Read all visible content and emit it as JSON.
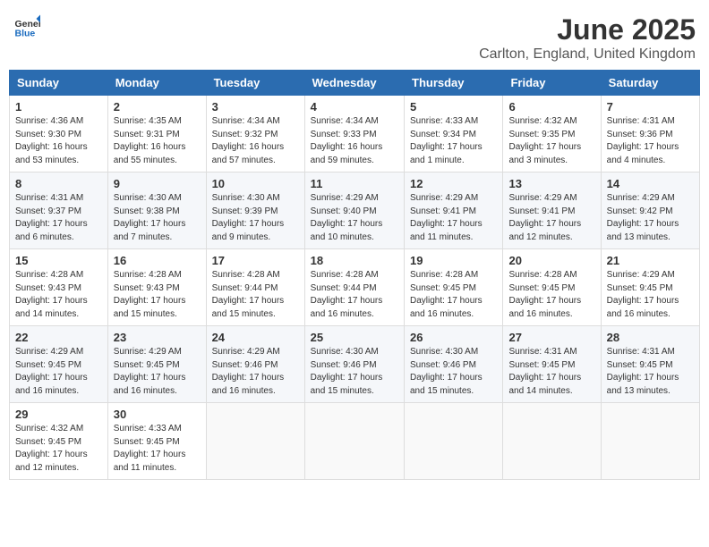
{
  "header": {
    "logo_general": "General",
    "logo_blue": "Blue",
    "title": "June 2025",
    "subtitle": "Carlton, England, United Kingdom"
  },
  "days_of_week": [
    "Sunday",
    "Monday",
    "Tuesday",
    "Wednesday",
    "Thursday",
    "Friday",
    "Saturday"
  ],
  "weeks": [
    [
      {
        "day": "1",
        "sunrise": "4:36 AM",
        "sunset": "9:30 PM",
        "daylight": "16 hours and 53 minutes."
      },
      {
        "day": "2",
        "sunrise": "4:35 AM",
        "sunset": "9:31 PM",
        "daylight": "16 hours and 55 minutes."
      },
      {
        "day": "3",
        "sunrise": "4:34 AM",
        "sunset": "9:32 PM",
        "daylight": "16 hours and 57 minutes."
      },
      {
        "day": "4",
        "sunrise": "4:34 AM",
        "sunset": "9:33 PM",
        "daylight": "16 hours and 59 minutes."
      },
      {
        "day": "5",
        "sunrise": "4:33 AM",
        "sunset": "9:34 PM",
        "daylight": "17 hours and 1 minute."
      },
      {
        "day": "6",
        "sunrise": "4:32 AM",
        "sunset": "9:35 PM",
        "daylight": "17 hours and 3 minutes."
      },
      {
        "day": "7",
        "sunrise": "4:31 AM",
        "sunset": "9:36 PM",
        "daylight": "17 hours and 4 minutes."
      }
    ],
    [
      {
        "day": "8",
        "sunrise": "4:31 AM",
        "sunset": "9:37 PM",
        "daylight": "17 hours and 6 minutes."
      },
      {
        "day": "9",
        "sunrise": "4:30 AM",
        "sunset": "9:38 PM",
        "daylight": "17 hours and 7 minutes."
      },
      {
        "day": "10",
        "sunrise": "4:30 AM",
        "sunset": "9:39 PM",
        "daylight": "17 hours and 9 minutes."
      },
      {
        "day": "11",
        "sunrise": "4:29 AM",
        "sunset": "9:40 PM",
        "daylight": "17 hours and 10 minutes."
      },
      {
        "day": "12",
        "sunrise": "4:29 AM",
        "sunset": "9:41 PM",
        "daylight": "17 hours and 11 minutes."
      },
      {
        "day": "13",
        "sunrise": "4:29 AM",
        "sunset": "9:41 PM",
        "daylight": "17 hours and 12 minutes."
      },
      {
        "day": "14",
        "sunrise": "4:29 AM",
        "sunset": "9:42 PM",
        "daylight": "17 hours and 13 minutes."
      }
    ],
    [
      {
        "day": "15",
        "sunrise": "4:28 AM",
        "sunset": "9:43 PM",
        "daylight": "17 hours and 14 minutes."
      },
      {
        "day": "16",
        "sunrise": "4:28 AM",
        "sunset": "9:43 PM",
        "daylight": "17 hours and 15 minutes."
      },
      {
        "day": "17",
        "sunrise": "4:28 AM",
        "sunset": "9:44 PM",
        "daylight": "17 hours and 15 minutes."
      },
      {
        "day": "18",
        "sunrise": "4:28 AM",
        "sunset": "9:44 PM",
        "daylight": "17 hours and 16 minutes."
      },
      {
        "day": "19",
        "sunrise": "4:28 AM",
        "sunset": "9:45 PM",
        "daylight": "17 hours and 16 minutes."
      },
      {
        "day": "20",
        "sunrise": "4:28 AM",
        "sunset": "9:45 PM",
        "daylight": "17 hours and 16 minutes."
      },
      {
        "day": "21",
        "sunrise": "4:29 AM",
        "sunset": "9:45 PM",
        "daylight": "17 hours and 16 minutes."
      }
    ],
    [
      {
        "day": "22",
        "sunrise": "4:29 AM",
        "sunset": "9:45 PM",
        "daylight": "17 hours and 16 minutes."
      },
      {
        "day": "23",
        "sunrise": "4:29 AM",
        "sunset": "9:45 PM",
        "daylight": "17 hours and 16 minutes."
      },
      {
        "day": "24",
        "sunrise": "4:29 AM",
        "sunset": "9:46 PM",
        "daylight": "17 hours and 16 minutes."
      },
      {
        "day": "25",
        "sunrise": "4:30 AM",
        "sunset": "9:46 PM",
        "daylight": "17 hours and 15 minutes."
      },
      {
        "day": "26",
        "sunrise": "4:30 AM",
        "sunset": "9:46 PM",
        "daylight": "17 hours and 15 minutes."
      },
      {
        "day": "27",
        "sunrise": "4:31 AM",
        "sunset": "9:45 PM",
        "daylight": "17 hours and 14 minutes."
      },
      {
        "day": "28",
        "sunrise": "4:31 AM",
        "sunset": "9:45 PM",
        "daylight": "17 hours and 13 minutes."
      }
    ],
    [
      {
        "day": "29",
        "sunrise": "4:32 AM",
        "sunset": "9:45 PM",
        "daylight": "17 hours and 12 minutes."
      },
      {
        "day": "30",
        "sunrise": "4:33 AM",
        "sunset": "9:45 PM",
        "daylight": "17 hours and 11 minutes."
      },
      null,
      null,
      null,
      null,
      null
    ]
  ]
}
